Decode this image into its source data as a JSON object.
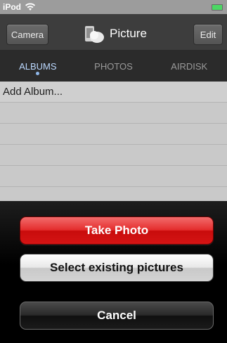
{
  "status_bar": {
    "carrier": "iPod",
    "wifi_icon": "wifi-icon",
    "battery_icon": "battery-icon"
  },
  "nav_bar": {
    "left_button": "Camera",
    "title": "Picture",
    "title_icon": "picture-logo-icon",
    "right_button": "Edit"
  },
  "tabs": [
    {
      "label": "ALBUMS",
      "active": true
    },
    {
      "label": "PHOTOS",
      "active": false
    },
    {
      "label": "AIRDISK",
      "active": false
    }
  ],
  "list": {
    "first_row": "Add Album..."
  },
  "action_sheet": {
    "take_photo": "Take Photo",
    "select_existing": "Select existing pictures",
    "cancel": "Cancel"
  },
  "colors": {
    "accent_active_tab": "#bcd9ff",
    "destructive_button": "#e42c2c"
  }
}
